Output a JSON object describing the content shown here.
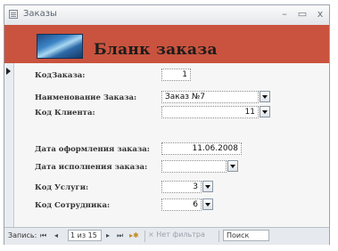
{
  "window": {
    "title": "Заказы",
    "min_label": "–",
    "max_label": "▭",
    "close_label": "x"
  },
  "header": {
    "title": "Бланк заказа"
  },
  "fields": {
    "order_id": {
      "label": "КодЗаказа:",
      "value": "1"
    },
    "order_name": {
      "label": "Наименование Заказа:",
      "value": "Заказ №7"
    },
    "client_id": {
      "label": "Код Клиента:",
      "value": "11"
    },
    "order_date": {
      "label": "Дата оформления заказа:",
      "value": "11.06.2008"
    },
    "completion_date": {
      "label": "Дата исполнения заказа:",
      "value": ""
    },
    "service_id": {
      "label": "Код Услуги:",
      "value": "3"
    },
    "employee_id": {
      "label": "Код Сотрудника:",
      "value": "6"
    }
  },
  "navbar": {
    "record_label": "Запись:",
    "first": "⏮",
    "prev": "◂",
    "record_position": "1 из 15",
    "next": "▸",
    "last": "⏭",
    "new": "▸✱",
    "filter_label": "Нет фильтра",
    "search_label": "Поиск"
  },
  "colors": {
    "header_band": "#c9533e",
    "form_background": "#f0f0f0"
  }
}
